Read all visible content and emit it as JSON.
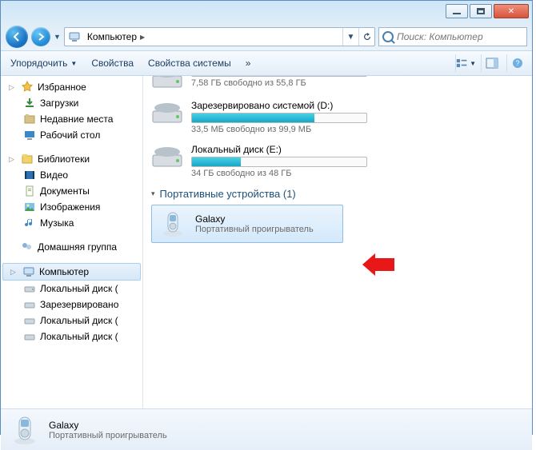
{
  "window": {
    "breadcrumb": "Компьютер",
    "search_placeholder": "Поиск: Компьютер"
  },
  "toolbar": {
    "organize": "Упорядочить",
    "properties": "Свойства",
    "system_properties": "Свойства системы",
    "more": "»"
  },
  "sidebar": {
    "favorites": {
      "label": "Избранное",
      "items": [
        "Загрузки",
        "Недавние места",
        "Рабочий стол"
      ]
    },
    "libraries": {
      "label": "Библиотеки",
      "items": [
        "Видео",
        "Документы",
        "Изображения",
        "Музыка"
      ]
    },
    "homegroup": {
      "label": "Домашняя группа"
    },
    "computer": {
      "label": "Компьютер",
      "items": [
        "Локальный диск (",
        "Зарезервировано",
        "Локальный диск (",
        "Локальный диск ("
      ]
    }
  },
  "drives": [
    {
      "name": "",
      "info": "7,58 ГБ свободно из 55,8 ГБ",
      "fill_pct": 100,
      "head": false
    },
    {
      "name": "Зарезервировано системой (D:)",
      "info": "33,5 МБ свободно из 99,9 МБ",
      "fill_pct": 70,
      "head": true
    },
    {
      "name": "Локальный диск (E:)",
      "info": "34 ГБ  свободно из 48 ГБ",
      "fill_pct": 28,
      "head": true
    }
  ],
  "section": {
    "title": "Портативные устройства (1)"
  },
  "device": {
    "name": "Galaxy",
    "subtitle": "Портативный проигрыватель"
  },
  "status": {
    "name": "Galaxy",
    "subtitle": "Портативный проигрыватель"
  }
}
